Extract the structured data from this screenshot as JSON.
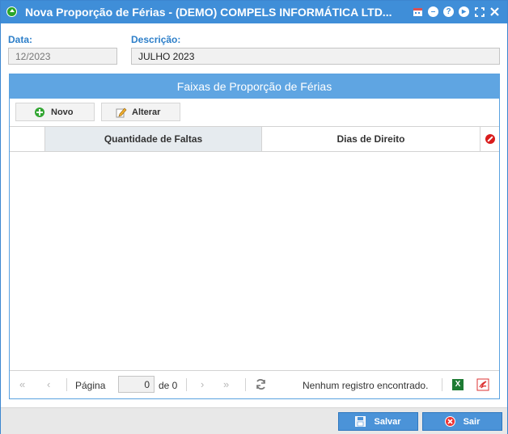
{
  "window": {
    "title": "Nova Proporção de Férias - (DEMO) COMPELS INFORMÁTICA LTD...",
    "controls": [
      "calendar-icon",
      "minimize-icon",
      "help-icon",
      "next-icon",
      "maximize-icon",
      "close-icon"
    ]
  },
  "form": {
    "data_label": "Data:",
    "data_value": "12/2023",
    "descricao_label": "Descrição:",
    "descricao_value": "JULHO 2023"
  },
  "panel": {
    "title": "Faixas de Proporção de Férias",
    "toolbar": {
      "novo_label": "Novo",
      "alterar_label": "Alterar"
    },
    "columns": [
      "Quantidade de Faltas",
      "Dias de Direito"
    ],
    "rows": []
  },
  "pager": {
    "page_label": "Página",
    "page_value": "0",
    "of_label": "de 0",
    "status": "Nenhum registro encontrado."
  },
  "footer": {
    "save_label": "Salvar",
    "exit_label": "Sair"
  },
  "colors": {
    "titlebar": "#3f8ed8",
    "panel_header": "#5fa5e2",
    "label": "#2d7fc9",
    "button": "#4b93d8"
  }
}
